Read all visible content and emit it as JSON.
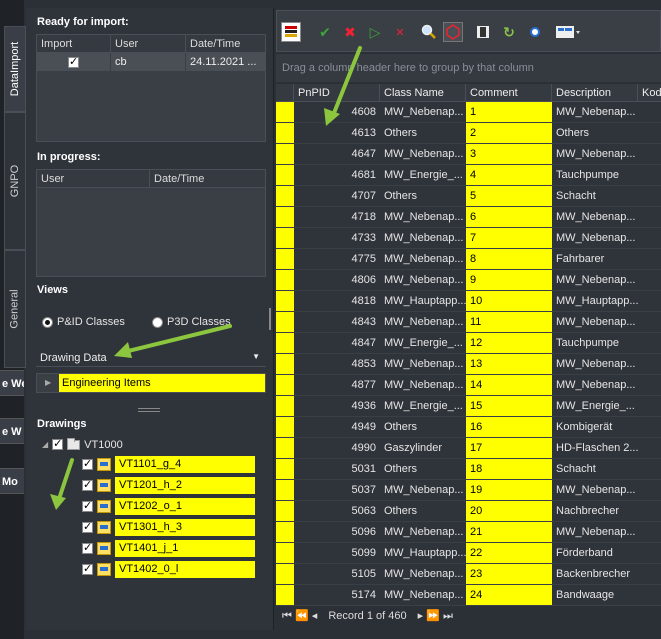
{
  "bg_buttons": [
    "e We",
    "e W",
    "Mo"
  ],
  "tabs": [
    "DataImport",
    "GNPO",
    "General"
  ],
  "ready": {
    "title": "Ready for import:",
    "headers": [
      "Import",
      "User",
      "Date/Time"
    ],
    "row": {
      "user": "cb",
      "date": "24.11.2021 ..."
    }
  },
  "progress": {
    "title": "In progress:",
    "headers": [
      "User",
      "Date/Time"
    ]
  },
  "views": {
    "title": "Views",
    "options": [
      "P&ID Classes",
      "P3D Classes"
    ],
    "selected": "P&ID Classes",
    "dropdown_value": "Drawing Data",
    "tree_item": "Engineering Items"
  },
  "drawings": {
    "title": "Drawings",
    "root": "VT1000",
    "items": [
      "VT1101_g_4",
      "VT1201_h_2",
      "VT1202_o_1",
      "VT1301_h_3",
      "VT1401_j_1",
      "VT1402_0_l"
    ]
  },
  "toolbar": {
    "icons": [
      "grid-color-icon",
      "accept-icon",
      "reject-icon",
      "run-icon",
      "remove-icon",
      "zoom-icon",
      "select-icon",
      "film-icon",
      "refresh-icon",
      "dot-icon",
      "layout-icon"
    ]
  },
  "group_hint": "Drag a column header here to group by that column",
  "table": {
    "headers": [
      "PnPID",
      "Class Name",
      "Comment",
      "Description",
      "Kod"
    ],
    "rows": [
      [
        "4608",
        "MW_Nebenap...",
        "1",
        "MW_Nebenap..."
      ],
      [
        "4613",
        "Others",
        "2",
        "Others"
      ],
      [
        "4647",
        "MW_Nebenap...",
        "3",
        "MW_Nebenap..."
      ],
      [
        "4681",
        "MW_Energie_...",
        "4",
        "Tauchpumpe"
      ],
      [
        "4707",
        "Others",
        "5",
        "Schacht"
      ],
      [
        "4718",
        "MW_Nebenap...",
        "6",
        "MW_Nebenap..."
      ],
      [
        "4733",
        "MW_Nebenap...",
        "7",
        "MW_Nebenap..."
      ],
      [
        "4775",
        "MW_Nebenap...",
        "8",
        "Fahrbarer"
      ],
      [
        "4806",
        "MW_Nebenap...",
        "9",
        "MW_Nebenap..."
      ],
      [
        "4818",
        "MW_Hauptapp...",
        "10",
        "MW_Hauptapp..."
      ],
      [
        "4843",
        "MW_Nebenap...",
        "11",
        "MW_Nebenap..."
      ],
      [
        "4847",
        "MW_Energie_...",
        "12",
        "Tauchpumpe"
      ],
      [
        "4853",
        "MW_Nebenap...",
        "13",
        "MW_Nebenap..."
      ],
      [
        "4877",
        "MW_Nebenap...",
        "14",
        "MW_Nebenap..."
      ],
      [
        "4936",
        "MW_Energie_...",
        "15",
        "MW_Energie_..."
      ],
      [
        "4949",
        "Others",
        "16",
        "Kombigerät"
      ],
      [
        "4990",
        "Gaszylinder",
        "17",
        "HD-Flaschen 2..."
      ],
      [
        "5031",
        "Others",
        "18",
        "Schacht"
      ],
      [
        "5037",
        "MW_Nebenap...",
        "19",
        "MW_Nebenap..."
      ],
      [
        "5063",
        "Others",
        "20",
        "Nachbrecher"
      ],
      [
        "5096",
        "MW_Nebenap...",
        "21",
        "MW_Nebenap..."
      ],
      [
        "5099",
        "MW_Hauptapp...",
        "22",
        "Förderband"
      ],
      [
        "5105",
        "MW_Nebenap...",
        "23",
        "Backenbrecher"
      ],
      [
        "5174",
        "MW_Nebenap...",
        "24",
        "Bandwaage"
      ]
    ]
  },
  "pager": {
    "text": "Record 1 of 460"
  }
}
